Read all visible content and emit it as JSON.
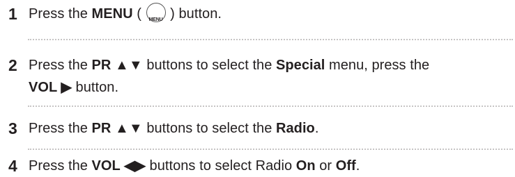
{
  "steps": [
    {
      "number": "1",
      "t1": "Press the ",
      "b1": "MENU",
      "t2": " ( ",
      "icon_label": "MENU",
      "t3": " ) button."
    },
    {
      "number": "2",
      "t1": "Press the ",
      "b1": "PR ▲▼",
      "t2": " buttons to select the ",
      "b2": "Special",
      "t3": " menu, press the",
      "b3": "VOL ▶",
      "t4": " button."
    },
    {
      "number": "3",
      "t1": "Press the ",
      "b1": "PR ▲▼",
      "t2": " buttons to select the ",
      "b2": "Radio",
      "t3": "."
    },
    {
      "number": "4",
      "t1": "Press the ",
      "b1": "VOL ◀▶",
      "t2": " buttons to select Radio ",
      "b2": "On",
      "t3": " or ",
      "b3": "Off",
      "t4": "."
    }
  ]
}
